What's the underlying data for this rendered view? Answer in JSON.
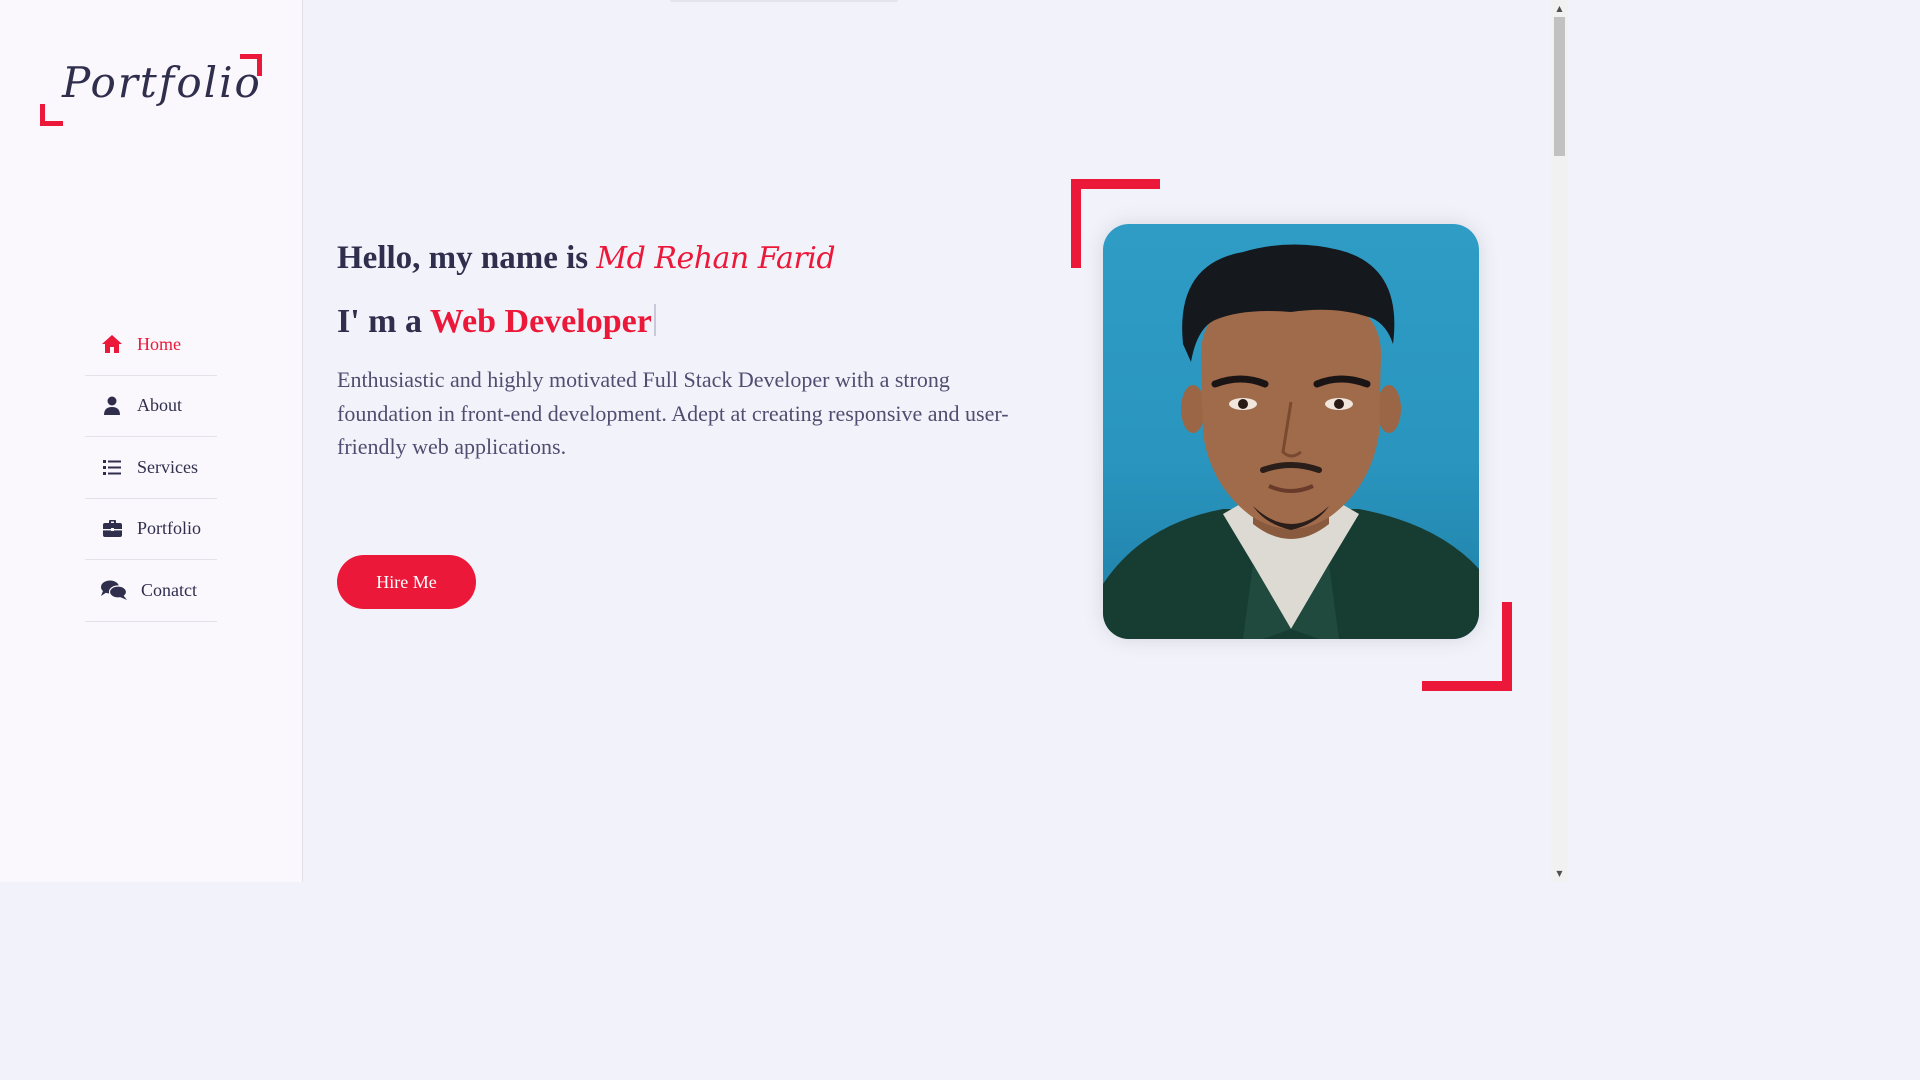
{
  "sidebar": {
    "logo_text": "Portfolio",
    "nav": [
      {
        "label": "Home",
        "icon": "home-icon",
        "active": true
      },
      {
        "label": "About",
        "icon": "user-icon",
        "active": false
      },
      {
        "label": "Services",
        "icon": "list-icon",
        "active": false
      },
      {
        "label": "Portfolio",
        "icon": "briefcase-icon",
        "active": false
      },
      {
        "label": "Conatct",
        "icon": "comments-icon",
        "active": false
      }
    ]
  },
  "hero": {
    "greeting_prefix": "Hello, my name is",
    "name": "Md Rehan Farid",
    "role_prefix": "I' m a",
    "role": "Web Developer",
    "intro": "Enthusiastic and highly motivated Full Stack Developer with a strong foundation in front-end development. Adept at creating responsive and user-friendly web applications.",
    "cta_label": "Hire Me"
  },
  "colors": {
    "accent": "#ec1839",
    "text": "#302e4d",
    "background": "#f2f3fa"
  }
}
